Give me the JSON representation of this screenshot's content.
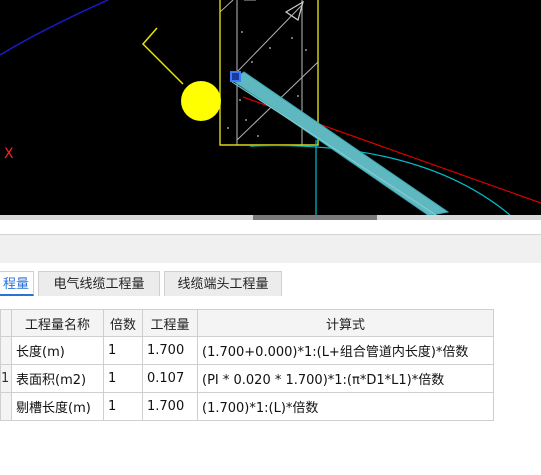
{
  "canvas": {
    "background": "#000000",
    "axis_marker_label": "X",
    "colors": {
      "blue_curve": "#1a1ad0",
      "yellow": "#ffff00",
      "white_frame": "#cfcfcf",
      "red_line": "#d80000",
      "cyan": "#00c0d0",
      "pipe_fill": "#5fb8bf",
      "pipe_edge": "#3aa7b2",
      "selection_grip": "#3b7bff"
    }
  },
  "scrollbar": {
    "thumb_color": "#7a7a7a",
    "track_color": "#d9d9d9"
  },
  "tabs": [
    {
      "label": "程量",
      "active": true
    },
    {
      "label": "电气线缆工程量",
      "active": false
    },
    {
      "label": "线缆端头工程量",
      "active": false
    }
  ],
  "table": {
    "columns": [
      "工程量名称",
      "倍数",
      "工程量",
      "计算式"
    ],
    "rows": [
      {
        "marker": "",
        "name": "长度(m)",
        "multiple": "1",
        "quantity": "1.700",
        "formula": "(1.700+0.000)*1:(L+组合管道内长度)*倍数"
      },
      {
        "marker": "1",
        "name": "表面积(m2)",
        "multiple": "1",
        "quantity": "0.107",
        "formula": "(PI * 0.020 * 1.700)*1:(π*D1*L1)*倍数"
      },
      {
        "marker": "",
        "name": "剔槽长度(m)",
        "multiple": "1",
        "quantity": "1.700",
        "formula": "(1.700)*1:(L)*倍数"
      }
    ]
  }
}
